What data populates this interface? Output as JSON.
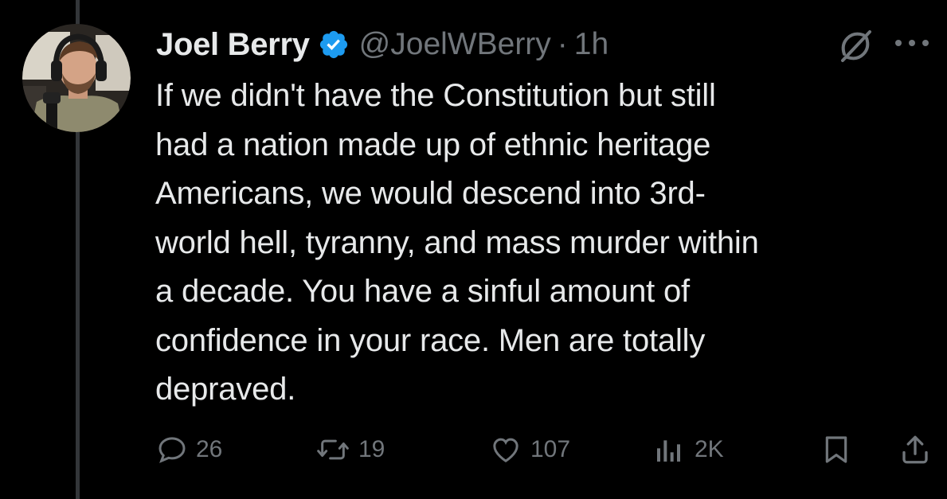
{
  "author": {
    "name": "Joel Berry",
    "handle": "@JoelWBerry",
    "separator": "·",
    "time": "1h",
    "verified": true,
    "verified_color": "#1d9bf0"
  },
  "tweet": {
    "text": "If we didn't have the Constitution but still\nhad a nation made up of ethnic heritage\nAmericans, we would descend into 3rd-\nworld hell, tyranny, and mass murder within\na decade. You have a sinful amount of\nconfidence in your race. Men are totally\ndepraved."
  },
  "actions": {
    "replies": "26",
    "reposts": "19",
    "likes": "107",
    "views": "2K"
  },
  "icons": [
    "grok-icon",
    "more-icon",
    "reply-icon",
    "repost-icon",
    "like-icon",
    "views-icon",
    "bookmark-icon",
    "share-icon",
    "verified-badge-icon"
  ],
  "colors": {
    "background": "#000000",
    "text": "#e7e9ea",
    "secondary": "#71767b",
    "thread_line": "#333639"
  }
}
